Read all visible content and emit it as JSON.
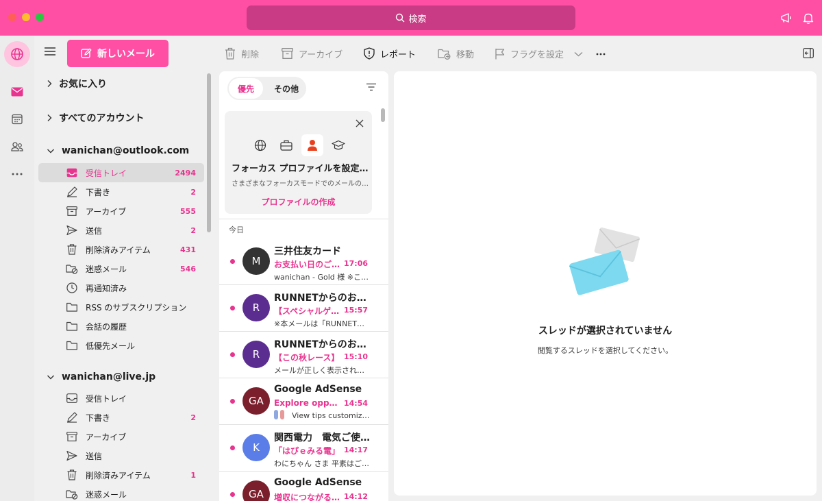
{
  "colors": {
    "accent": "#ff4fa5",
    "accent_text": "#e8338f",
    "search_bg": "#c93b84"
  },
  "titlebar": {
    "search_placeholder": "検索"
  },
  "folders_pane": {
    "new_mail_label": "新しいメール",
    "favorites_label": "お気に入り",
    "all_accounts_label": "すべてのアカウント",
    "accounts": [
      {
        "name": "wanichan@outlook.com",
        "folders": [
          {
            "name": "受信トレイ",
            "count": "2494",
            "icon": "inbox-icon"
          },
          {
            "name": "下書き",
            "count": "2",
            "icon": "drafts-icon"
          },
          {
            "name": "アーカイブ",
            "count": "555",
            "icon": "archive-icon"
          },
          {
            "name": "送信",
            "count": "2",
            "icon": "sent-icon"
          },
          {
            "name": "削除済みアイテム",
            "count": "431",
            "icon": "trash-icon"
          },
          {
            "name": "迷惑メール",
            "count": "546",
            "icon": "junk-icon"
          },
          {
            "name": "再通知済み",
            "count": "",
            "icon": "snooze-icon"
          },
          {
            "name": "RSS のサブスクリプション",
            "count": "",
            "icon": "folder-icon"
          },
          {
            "name": "会話の履歴",
            "count": "",
            "icon": "folder-icon"
          },
          {
            "name": "低優先メール",
            "count": "",
            "icon": "folder-icon"
          }
        ]
      },
      {
        "name": "wanichan@live.jp",
        "folders": [
          {
            "name": "受信トレイ",
            "count": "",
            "icon": "inbox-icon"
          },
          {
            "name": "下書き",
            "count": "2",
            "icon": "drafts-icon"
          },
          {
            "name": "アーカイブ",
            "count": "",
            "icon": "archive-icon"
          },
          {
            "name": "送信",
            "count": "",
            "icon": "sent-icon"
          },
          {
            "name": "削除済みアイテム",
            "count": "1",
            "icon": "trash-icon"
          },
          {
            "name": "迷惑メール",
            "count": "",
            "icon": "junk-icon"
          }
        ]
      }
    ]
  },
  "toolbar": {
    "delete": "削除",
    "archive": "アーカイブ",
    "report": "レポート",
    "move": "移動",
    "flag": "フラグを設定"
  },
  "message_list": {
    "tab_focused": "優先",
    "tab_other": "その他",
    "focus_card": {
      "title": "フォーカス プロファイルを設定する",
      "subtitle": "さまざまなフォーカスモードでのメールの表示方法を設定します",
      "link": "プロファイルの作成"
    },
    "section_today": "今日",
    "messages": [
      {
        "initials": "M",
        "avatar_color": "#333333",
        "sender": "三井住友カード",
        "subject": "お支払い日のご案内",
        "time": "17:06",
        "preview": "wanichan - Gold 様 ※このメールは"
      },
      {
        "initials": "R",
        "avatar_color": "#5c2d91",
        "sender": "RUNNETからのお知らせ",
        "subject": "【スペシャルゲスト】",
        "time": "15:57",
        "preview": "※本メールは「RUNNET」会員"
      },
      {
        "initials": "R",
        "avatar_color": "#5c2d91",
        "sender": "RUNNETからのお知らせ",
        "subject": "【この秋レース】",
        "time": "15:10",
        "preview": "メールが正しく表示されない場合"
      },
      {
        "initials": "GA",
        "avatar_color": "#7a1f2b",
        "sender": "Google AdSense",
        "subject": "Explore opportunities",
        "time": "14:54",
        "preview": "View tips customized"
      },
      {
        "initials": "K",
        "avatar_color": "#5b7de8",
        "sender": "関西電力　電気ご使用量",
        "subject": "「はぴｅみる電」",
        "time": "14:17",
        "preview": "わにちゃん さま 平素はご利用"
      },
      {
        "initials": "GA",
        "avatar_color": "#7a1f2b",
        "sender": "Google AdSense",
        "subject": "増収につながるヒント",
        "time": "14:12",
        "preview": ""
      }
    ]
  },
  "reading_pane": {
    "empty_title": "スレッドが選択されていません",
    "empty_subtitle": "閲覧するスレッドを選択してください。"
  }
}
